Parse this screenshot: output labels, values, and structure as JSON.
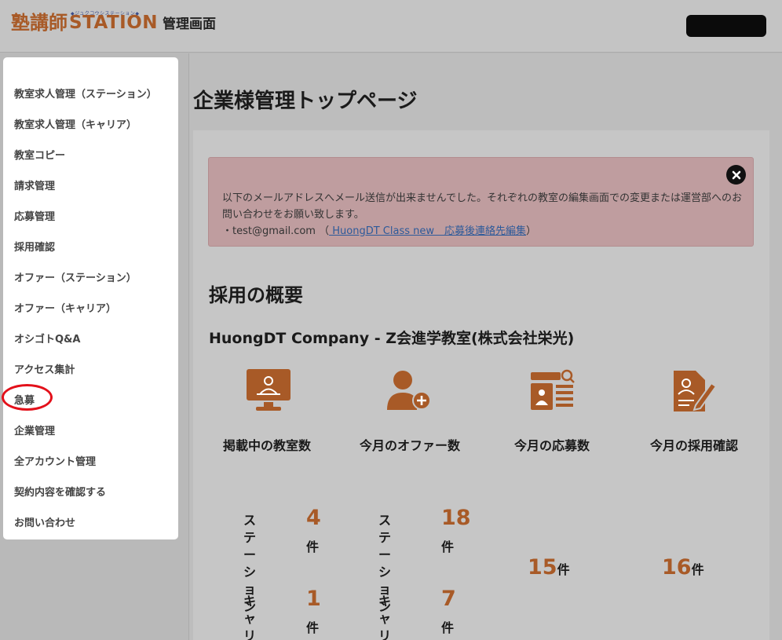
{
  "header": {
    "logo_jp": "塾講師",
    "logo_kana": "◆ジュクコウシステーション◆",
    "logo_station": "STATION",
    "admin_label": "管理画面",
    "account_label": ""
  },
  "sidebar": {
    "items": [
      {
        "label": "教室求人管理（ステーション）"
      },
      {
        "label": "教室求人管理（キャリア）"
      },
      {
        "label": "教室コピー"
      },
      {
        "label": "請求管理"
      },
      {
        "label": "応募管理"
      },
      {
        "label": "採用確認"
      },
      {
        "label": "オファー（ステーション）"
      },
      {
        "label": "オファー（キャリア）"
      },
      {
        "label": "オシゴトQ&A"
      },
      {
        "label": "アクセス集計"
      },
      {
        "label": "急募"
      },
      {
        "label": "企業管理"
      },
      {
        "label": "全アカウント管理"
      },
      {
        "label": "契約内容を確認する"
      },
      {
        "label": "お問い合わせ"
      }
    ],
    "highlighted_item": "急募"
  },
  "main": {
    "page_title": "企業様管理トップページ",
    "alert": {
      "message": "以下のメールアドレスへメール送信が出来ませんでした。それぞれの教室の編集画面での変更または運営部へのお問い合わせをお願い致します。",
      "email_line_prefix": "・test@gmail.com （",
      "link_text": " HuongDT Class new　応募後連絡先編集",
      "email_line_suffix": "）"
    },
    "section_title": "採用の概要",
    "company_name": "HuongDT Company - Z会進学教室(株式会社栄光)",
    "stats": [
      {
        "label": "掲載中の教室数",
        "icon": "monitor-user-icon",
        "station_label": "ステーション",
        "station_value": "4",
        "career_label": "キャリア",
        "career_value": "1",
        "unit": "件"
      },
      {
        "label": "今月のオファー数",
        "icon": "user-plus-icon",
        "station_label": "ステーション",
        "station_value": "18",
        "career_label": "キャリア",
        "career_value": "7",
        "unit": "件"
      },
      {
        "label": "今月の応募数",
        "icon": "id-card-search-icon",
        "value": "15",
        "unit": "件"
      },
      {
        "label": "今月の採用確認",
        "icon": "document-signature-icon",
        "value": "16",
        "unit": "件"
      }
    ]
  },
  "colors": {
    "accent": "#a85a27",
    "alert_bg": "#bf9d9f",
    "highlight": "#e3101a"
  }
}
